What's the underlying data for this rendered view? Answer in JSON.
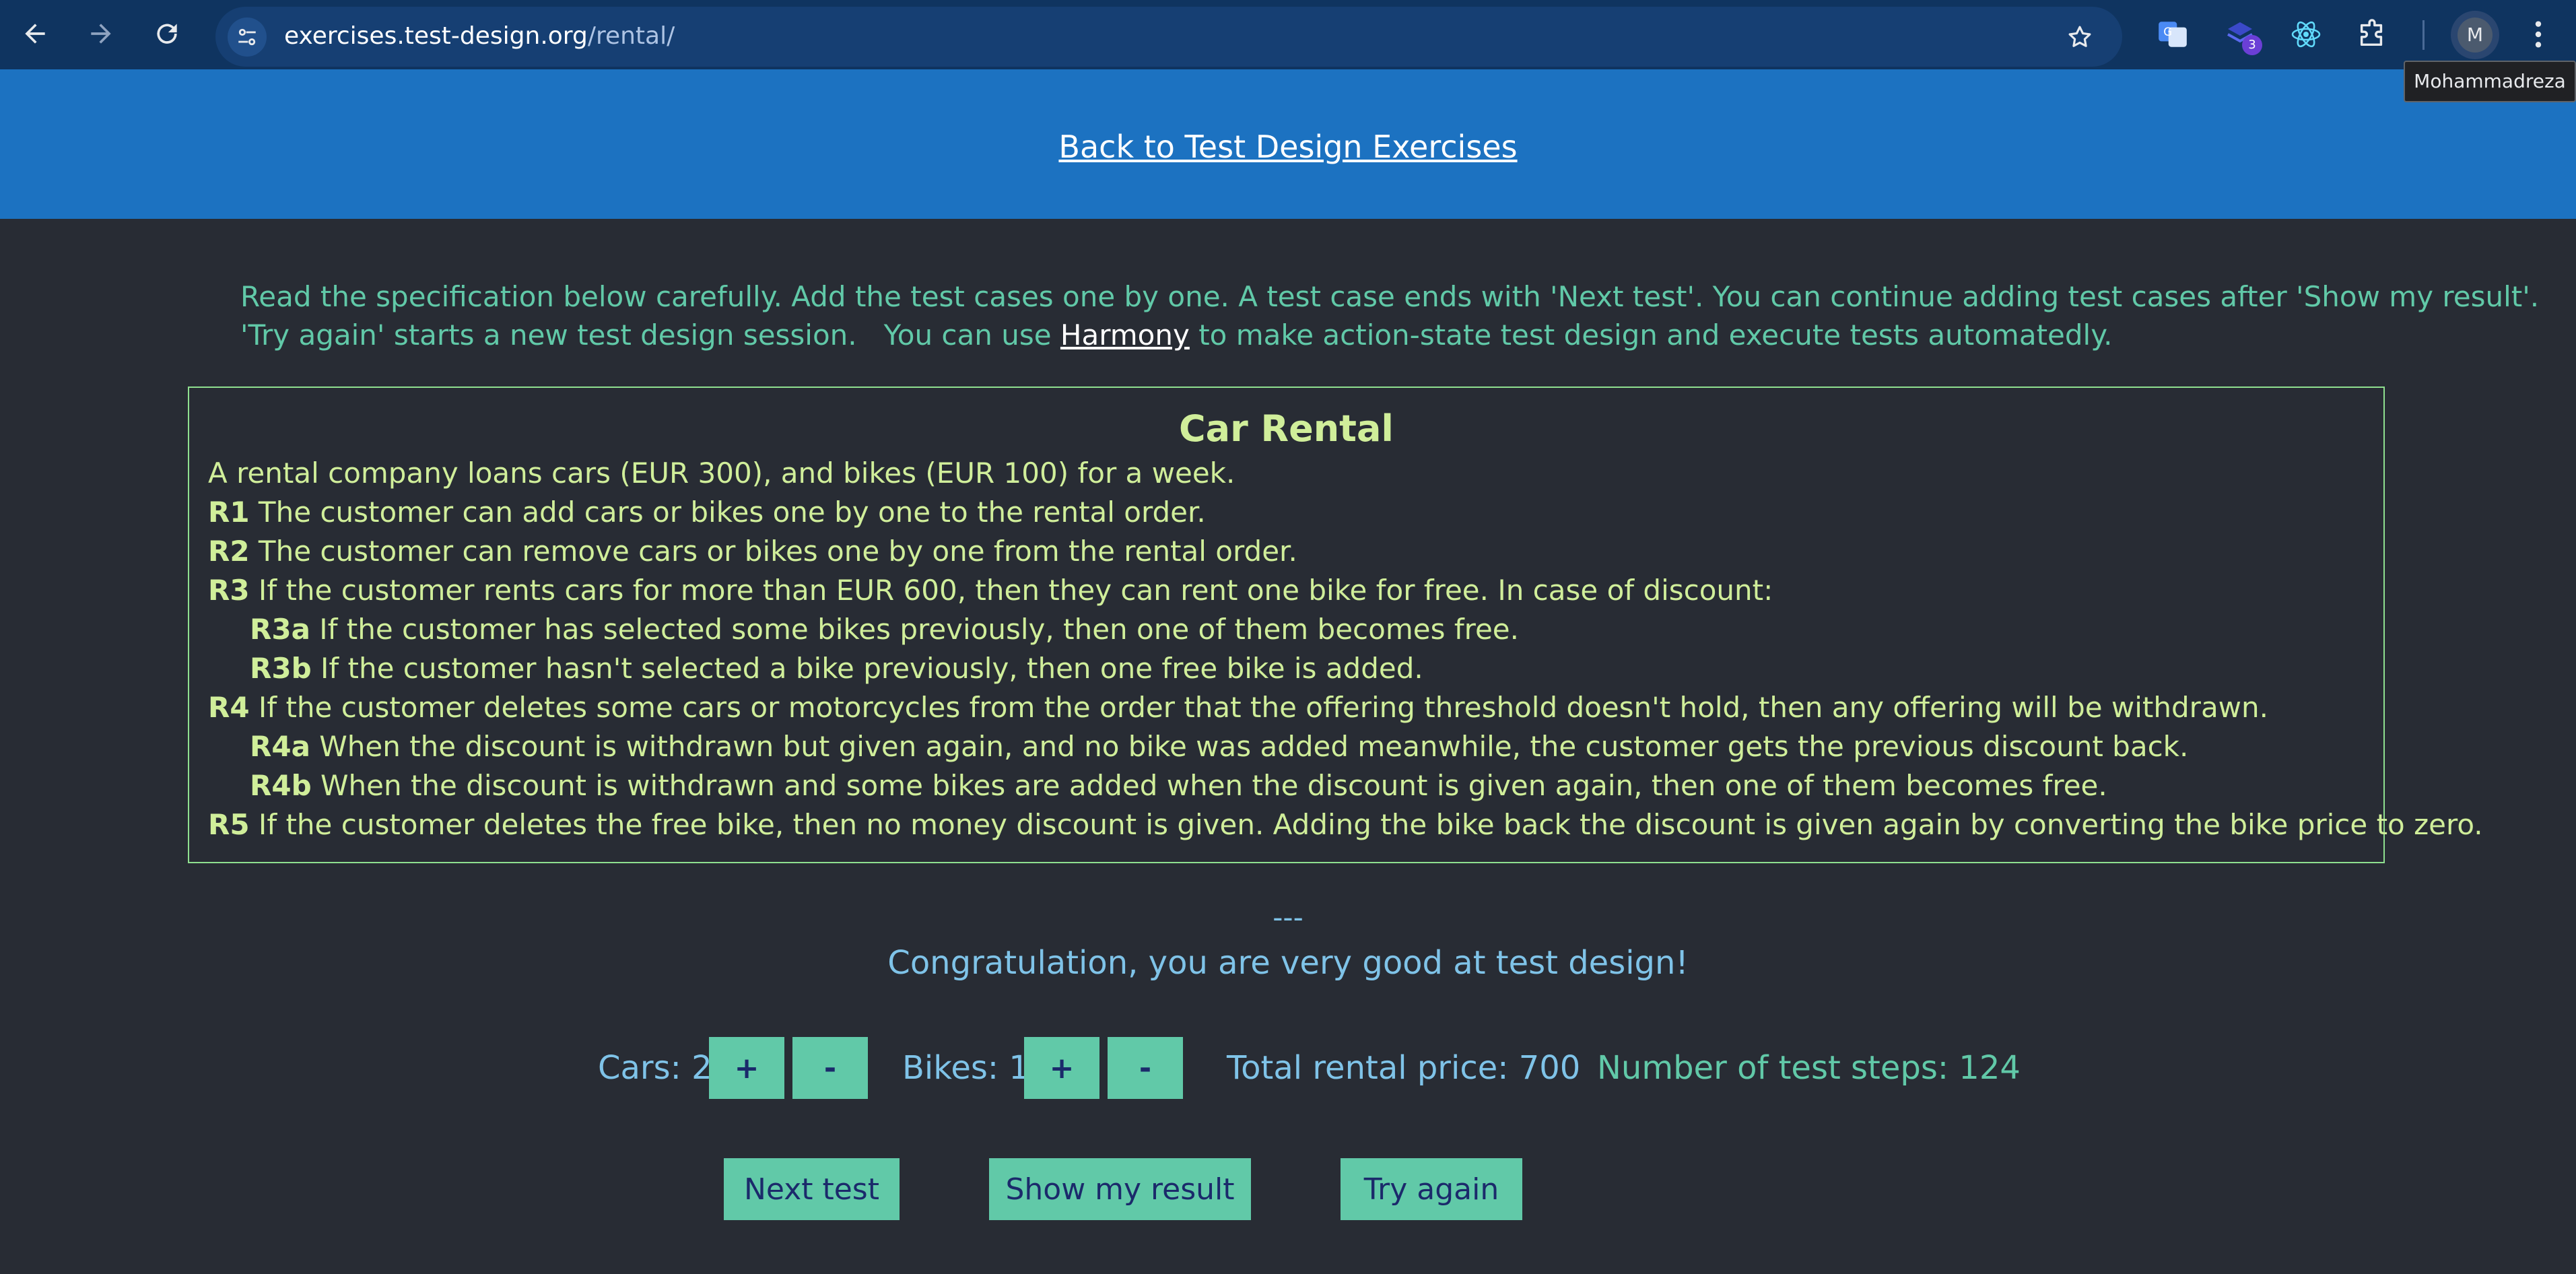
{
  "browser": {
    "url_host": "exercises.test-design.org",
    "url_path": "/rental/",
    "profile_initial": "M",
    "profile_tooltip": "Mohammadreza",
    "extension_badge": "3"
  },
  "header": {
    "back_link": "Back to Test Design Exercises"
  },
  "intro": {
    "line1": "Read the specification below carefully. Add the test cases one by one. A test case ends with 'Next test'. You can continue adding test cases after 'Show my result'.",
    "line2_before": "'Try again' starts a new test design session.   You can use ",
    "harmony_link": "Harmony",
    "line2_after": " to make action-state test design and execute tests automatedly."
  },
  "spec": {
    "title": "Car Rental",
    "intro": "A rental company loans cars (EUR 300), and bikes (EUR 100) for a week.",
    "rules": [
      {
        "id": "R1",
        "text": " The customer can add cars or bikes one by one to the rental order."
      },
      {
        "id": "R2",
        "text": " The customer can remove cars or bikes one by one from the rental order."
      },
      {
        "id": "R3",
        "text": " If the customer rents cars for more than EUR 600, then they can rent one bike for free. In case of discount:"
      },
      {
        "id": "R3a",
        "text": " If the customer has selected some bikes previously, then one of them becomes free."
      },
      {
        "id": "R3b",
        "text": " If the customer hasn't selected a bike previously, then one free bike is added."
      },
      {
        "id": "R4",
        "text": " If the customer deletes some cars or motorcycles from the order that the offering threshold doesn't hold, then any offering will be withdrawn."
      },
      {
        "id": "R4a",
        "text": " When the discount is withdrawn but given again, and no bike was added meanwhile, the customer gets the previous discount back."
      },
      {
        "id": "R4b",
        "text": " When the discount is withdrawn and some bikes are added when the discount is given again, then one of them becomes free."
      },
      {
        "id": "R5",
        "text": " If the customer deletes the free bike, then no money discount is given. Adding the bike back the discount is given again by converting the bike price to zero."
      }
    ]
  },
  "result": {
    "separator": "---",
    "message": "Congratulation, you are very good at test design!"
  },
  "counters": {
    "cars_label": "Cars: 2",
    "bikes_label": "Bikes: 1",
    "plus": "+",
    "minus": "-",
    "total_price": "Total rental price: 700",
    "test_steps": "Number of test steps: 124"
  },
  "actions": {
    "next_test": "Next test",
    "show_result": "Show my result",
    "try_again": "Try again"
  }
}
